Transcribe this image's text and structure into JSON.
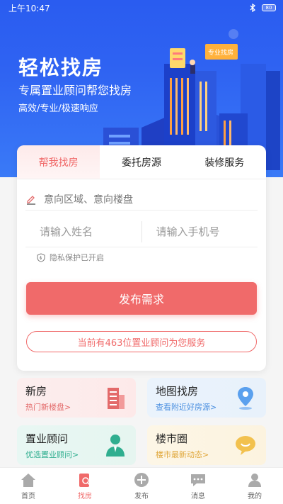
{
  "status": {
    "time": "上午10:47",
    "battery": "80"
  },
  "hero": {
    "title": "轻松找房",
    "subtitle": "专属置业顾问帮您找房",
    "tagline": "高效/专业/极速响应",
    "sign": "专业找房"
  },
  "tabs": [
    {
      "label": "帮我找房",
      "active": true
    },
    {
      "label": "委托房源",
      "active": false
    },
    {
      "label": "装修服务",
      "active": false
    }
  ],
  "form": {
    "area_placeholder": "意向区域、意向楼盘",
    "name_placeholder": "请输入姓名",
    "phone_placeholder": "请输入手机号",
    "privacy": "隐私保护已开启",
    "submit_label": "发布需求",
    "advisor_note": "当前有463位置业顾问为您服务"
  },
  "tiles": [
    {
      "title": "新房",
      "subtitle": "热门新楼盘>",
      "icon": "building-icon",
      "color": "#e36a6a"
    },
    {
      "title": "地图找房",
      "subtitle": "查看附近好房源>",
      "icon": "map-pin-icon",
      "color": "#4a8fe0"
    },
    {
      "title": "置业顾问",
      "subtitle": "优选置业顾问>",
      "icon": "advisor-icon",
      "color": "#2fae8f"
    },
    {
      "title": "楼市圈",
      "subtitle": "楼市最新动态>",
      "icon": "chat-bubble-icon",
      "color": "#e0a73a"
    }
  ],
  "tabbar": [
    {
      "label": "首页",
      "icon": "home-icon",
      "active": false
    },
    {
      "label": "找房",
      "icon": "find-house-icon",
      "active": true
    },
    {
      "label": "发布",
      "icon": "publish-plus-icon",
      "active": false
    },
    {
      "label": "消息",
      "icon": "message-icon",
      "active": false
    },
    {
      "label": "我的",
      "icon": "profile-icon",
      "active": false
    }
  ]
}
